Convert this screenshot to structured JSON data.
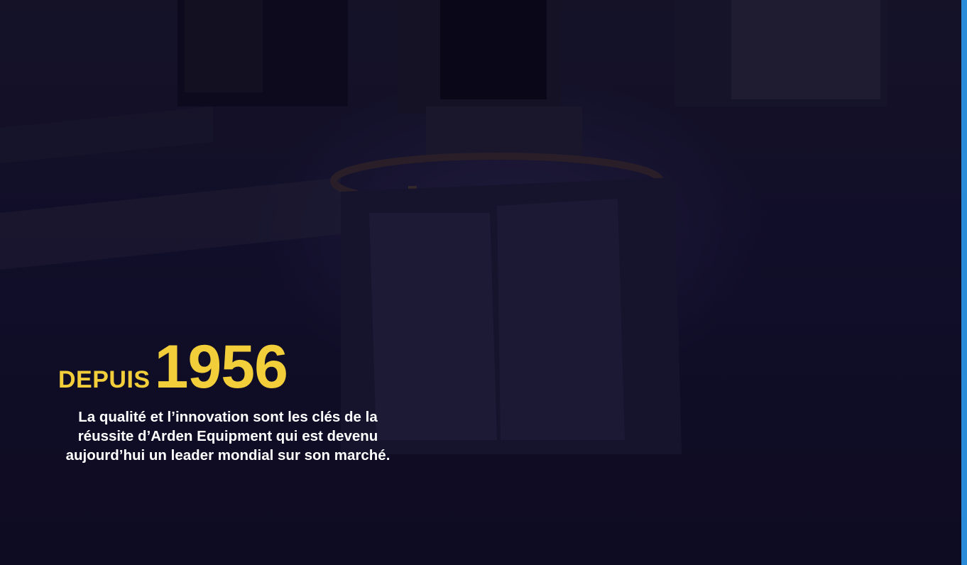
{
  "hero": {
    "label_prefix": "DEPUIS",
    "year": "1956",
    "tagline": "La qualité et l’innovation sont les clés de la réussite d’Arden Equipment qui est devenu aujourd’hui un leader mondial sur son marché."
  },
  "colors": {
    "accent": "#f2cf3a",
    "text": "#ffffff",
    "overlay": "#120f28",
    "scrollbar": "#2a8cd8"
  }
}
